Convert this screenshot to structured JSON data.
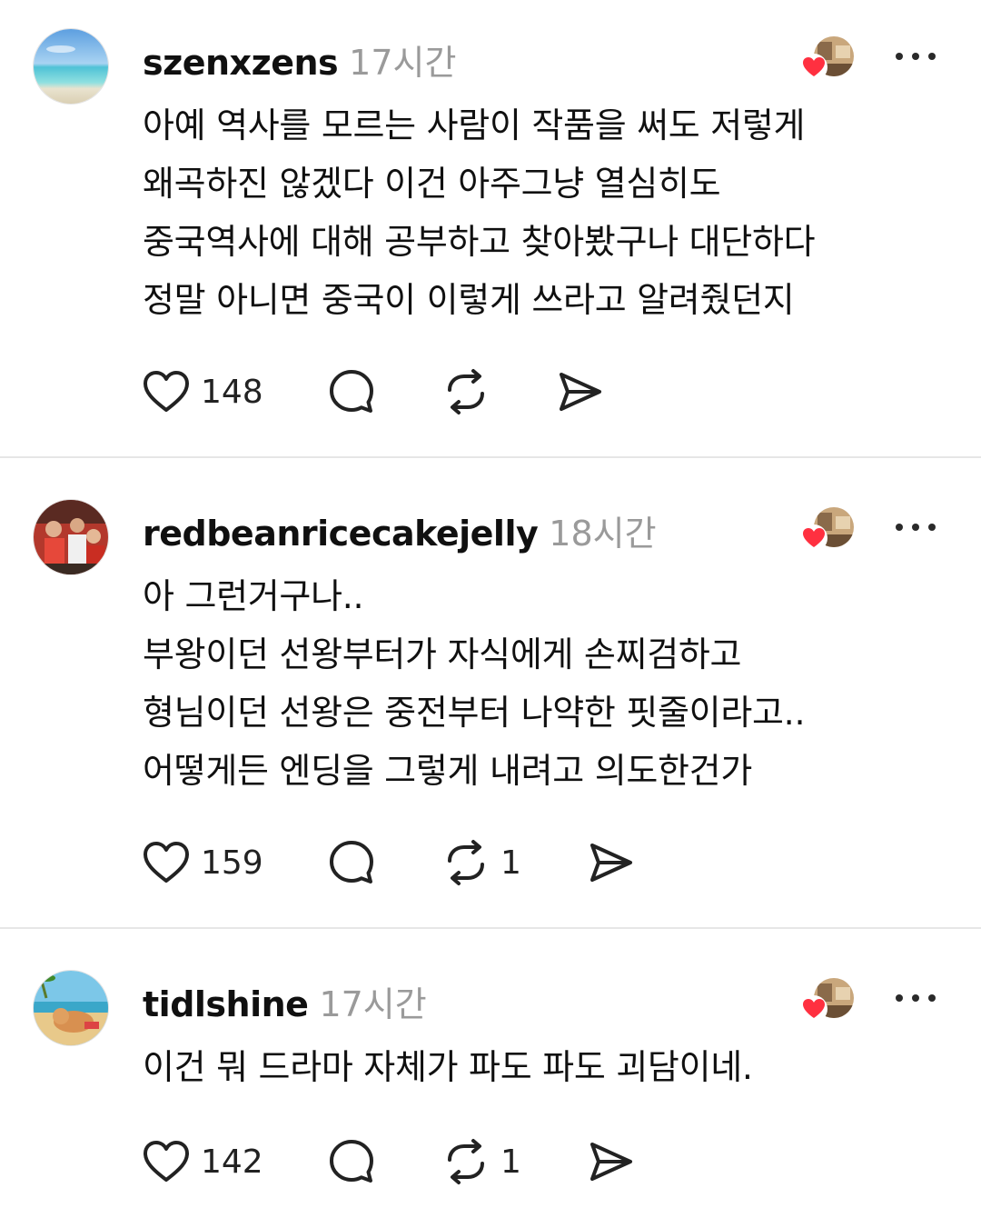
{
  "comments": [
    {
      "username": "szenxzens",
      "time": "17시간",
      "lines": [
        "아예 역사를 모르는 사람이 작품을 써도 저렇게",
        "왜곡하진 않겠다 이건 아주그냥 열심히도",
        "중국역사에 대해 공부하고 찾아봤구나 대단하다",
        "정말 아니면 중국이 이렇게 쓰라고 알려줬던지"
      ],
      "likes": "148",
      "reposts": ""
    },
    {
      "username": "redbeanricecakejelly",
      "time": "18시간",
      "lines": [
        "아 그런거구나..",
        "부왕이던 선왕부터가 자식에게 손찌검하고",
        "형님이던 선왕은 중전부터 나약한 핏줄이라고..",
        "어떻게든 엔딩을 그렇게 내려고 의도한건가"
      ],
      "likes": "159",
      "reposts": "1"
    },
    {
      "username": "tidlshine",
      "time": "17시간",
      "lines": [
        "이건 뭐 드라마 자체가 파도 파도 괴담이네."
      ],
      "likes": "142",
      "reposts": "1"
    }
  ],
  "icons": {
    "like": "heart-outline-icon",
    "reply": "speech-bubble-icon",
    "repost": "repost-arrows-icon",
    "share": "send-icon",
    "more": "more-horizontal-icon",
    "liked_badge": "red-heart-icon"
  },
  "colors": {
    "text": "#101010",
    "muted": "#9a9a9a",
    "heart": "#ff3040",
    "divider": "#e6e6e6"
  }
}
